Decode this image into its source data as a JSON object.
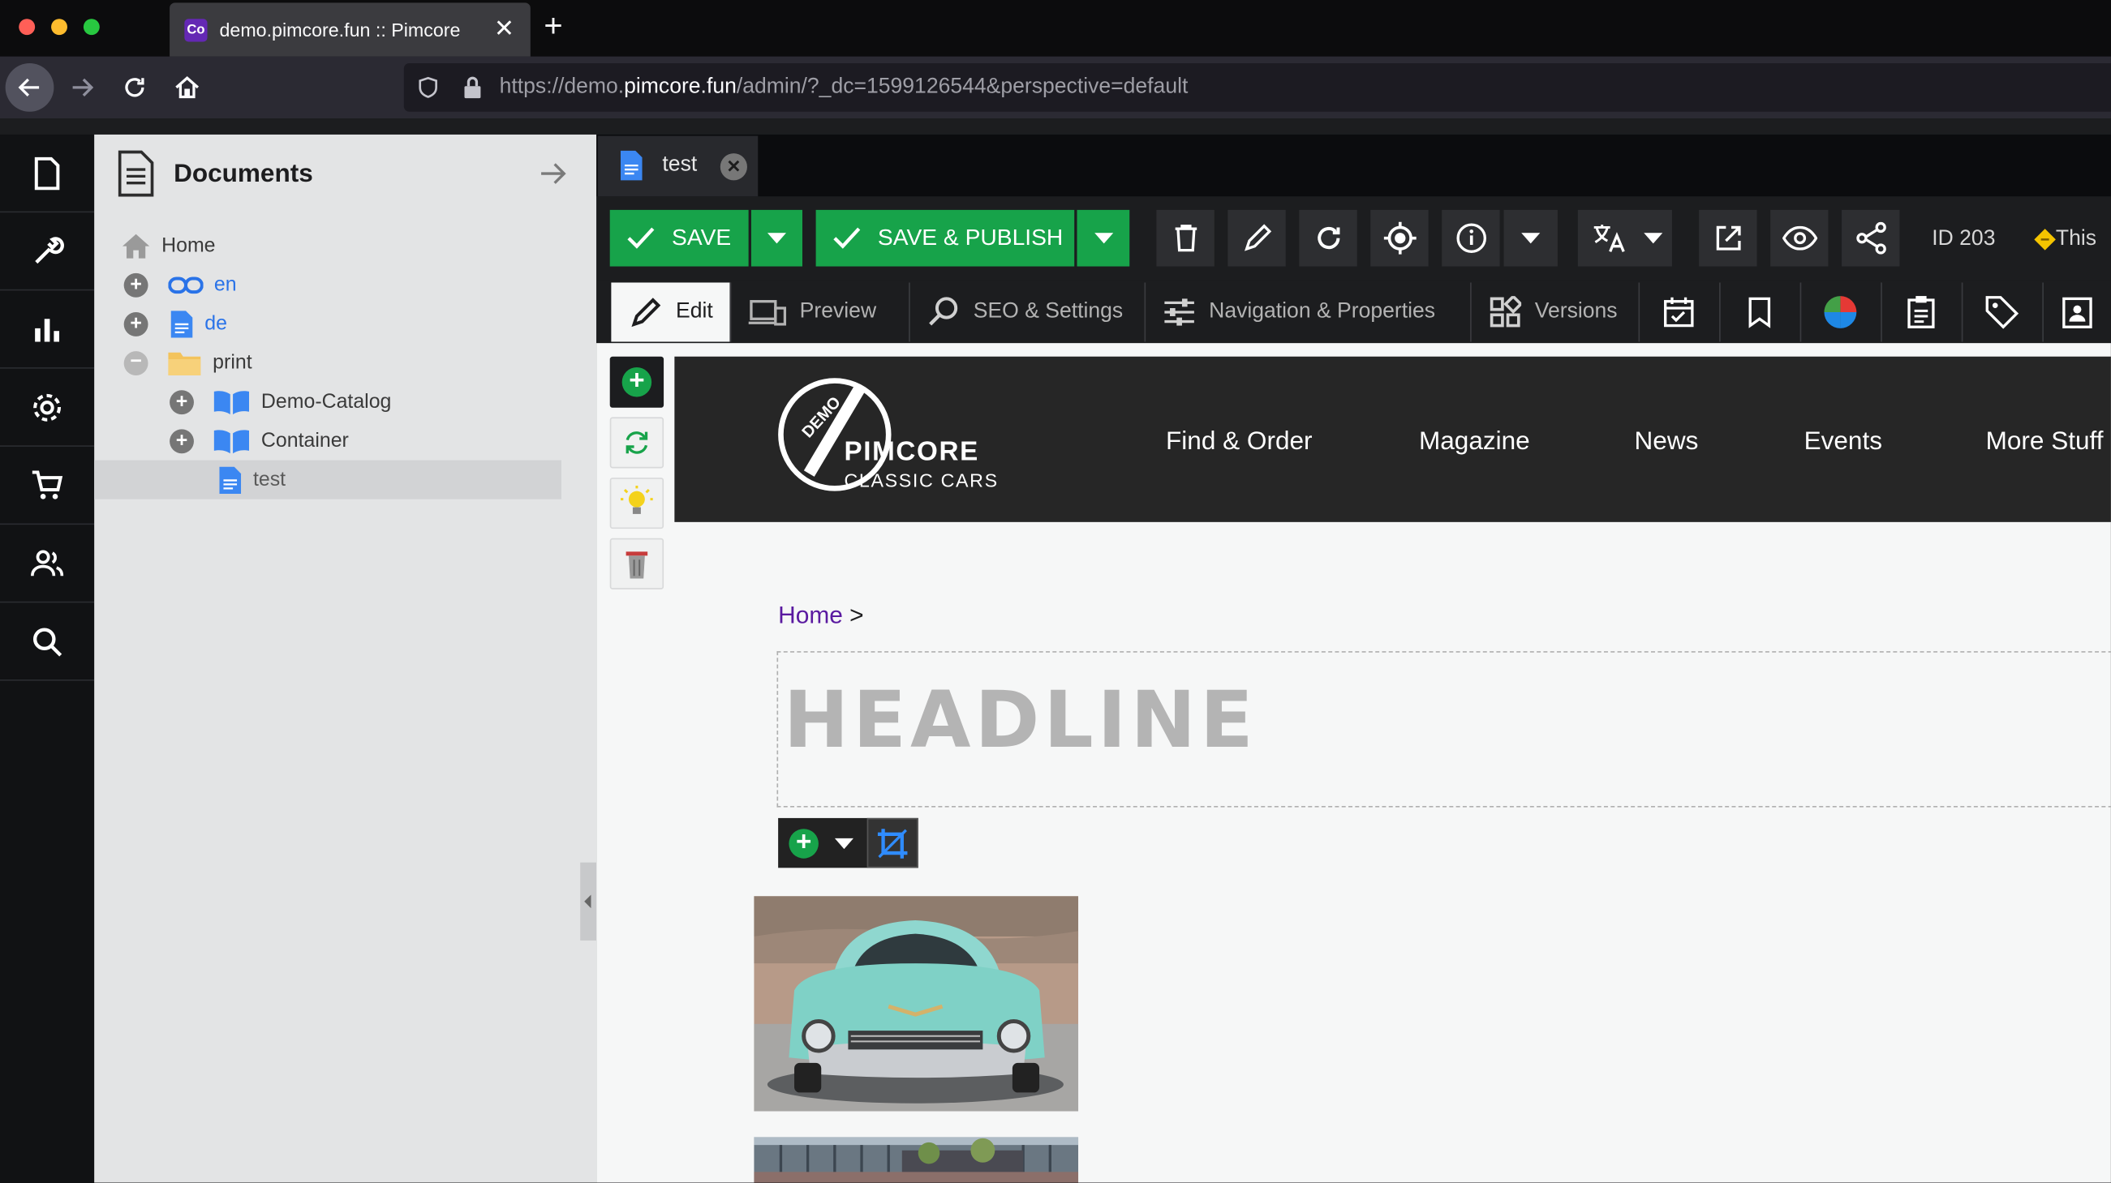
{
  "browser": {
    "tab_title": "demo.pimcore.fun :: Pimcore",
    "favicon_glyph": "Co",
    "url_prefix": "https://demo.",
    "url_domain": "pimcore.fun",
    "url_suffix": "/admin/?_dc=1599126544&perspective=default"
  },
  "tree": {
    "title": "Documents",
    "items": [
      {
        "label": "Home"
      },
      {
        "label": "en"
      },
      {
        "label": "de"
      },
      {
        "label": "print"
      },
      {
        "label": "Demo-Catalog"
      },
      {
        "label": "Container"
      },
      {
        "label": "test"
      }
    ]
  },
  "editor": {
    "tab_label": "test",
    "toolbar": {
      "save_label": "SAVE",
      "publish_label": "SAVE & PUBLISH",
      "id_label": "ID 203",
      "this_label": "This"
    },
    "subtabs": [
      "Edit",
      "Preview",
      "SEO & Settings",
      "Navigation & Properties",
      "Versions"
    ]
  },
  "site": {
    "logo_badge": "DEMO",
    "logo_main": "PIMCORE",
    "logo_sub": "CLASSIC CARS",
    "menu": [
      "Find & Order",
      "Magazine",
      "News",
      "Events",
      "More Stuff"
    ],
    "breadcrumb_home": "Home",
    "breadcrumb_sep": ">",
    "headline": "HEADLINE"
  },
  "colors": {
    "accent_green": "#17a34a",
    "link_purple": "#5a1aa0",
    "status_yellow": "#f4c400"
  }
}
